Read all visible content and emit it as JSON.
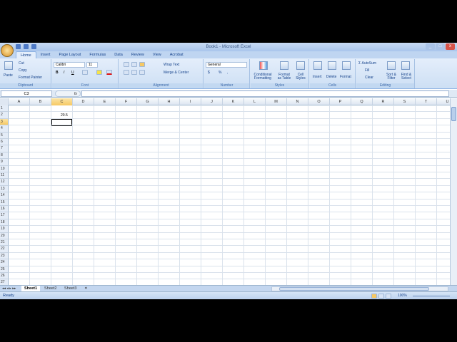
{
  "window": {
    "title": "Book1 - Microsoft Excel",
    "controls": [
      "_",
      "□",
      "x"
    ]
  },
  "ribbon_tabs": [
    "Home",
    "Insert",
    "Page Layout",
    "Formulas",
    "Data",
    "Review",
    "View",
    "Acrobat"
  ],
  "clipboard": {
    "paste": "Paste",
    "cut": "Cut",
    "copy": "Copy",
    "format_painter": "Format Painter",
    "label": "Clipboard"
  },
  "font": {
    "name": "Calibri",
    "size": "11",
    "bold": "B",
    "italic": "I",
    "underline": "U",
    "label": "Font"
  },
  "alignment": {
    "wrap": "Wrap Text",
    "merge": "Merge & Center",
    "label": "Alignment"
  },
  "number": {
    "format": "General",
    "currency": "$",
    "percent": "%",
    "comma": ",",
    "label": "Number"
  },
  "styles": {
    "conditional": "Conditional Formatting",
    "format_table": "Format as Table",
    "cell_styles": "Cell Styles",
    "label": "Styles"
  },
  "cells": {
    "insert": "Insert",
    "delete": "Delete",
    "format": "Format",
    "label": "Cells"
  },
  "editing": {
    "autosum": "AutoSum",
    "fill": "Fill",
    "clear": "Clear",
    "sort": "Sort & Filter",
    "find": "Find & Select",
    "label": "Editing"
  },
  "formula_bar": {
    "name_box": "C3",
    "fx": "fx",
    "value": ""
  },
  "columns": [
    "A",
    "B",
    "C",
    "D",
    "E",
    "F",
    "G",
    "H",
    "I",
    "J",
    "K",
    "L",
    "M",
    "N",
    "O",
    "P",
    "Q",
    "R",
    "S",
    "T",
    "U"
  ],
  "rows": 27,
  "selected": {
    "col": "C",
    "row": 3
  },
  "cells_data": [
    {
      "ref": "C2",
      "value": "20.5"
    }
  ],
  "sheets": [
    "Sheet1",
    "Sheet2",
    "Sheet3"
  ],
  "active_sheet": "Sheet1",
  "status": {
    "ready": "Ready",
    "zoom": "100%"
  }
}
